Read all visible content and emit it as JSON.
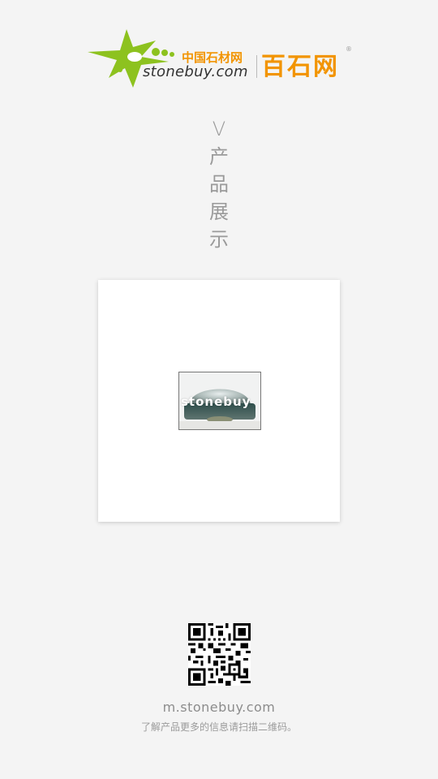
{
  "header": {
    "logo_cn_small": "中国石材网",
    "logo_en": "stonebuy.com",
    "logo_brand": "百石网",
    "registered_mark": "®"
  },
  "title": {
    "chars": [
      "V",
      "产",
      "品",
      "展",
      "示"
    ]
  },
  "product": {
    "watermark": "stonebuy"
  },
  "footer": {
    "site": "m.stonebuy.com",
    "hint": "了解产品更多的信息请扫描二维码。"
  },
  "colors": {
    "brand_orange": "#f29400",
    "logo_green": "#8dc21f",
    "background": "#f4f4f4"
  }
}
